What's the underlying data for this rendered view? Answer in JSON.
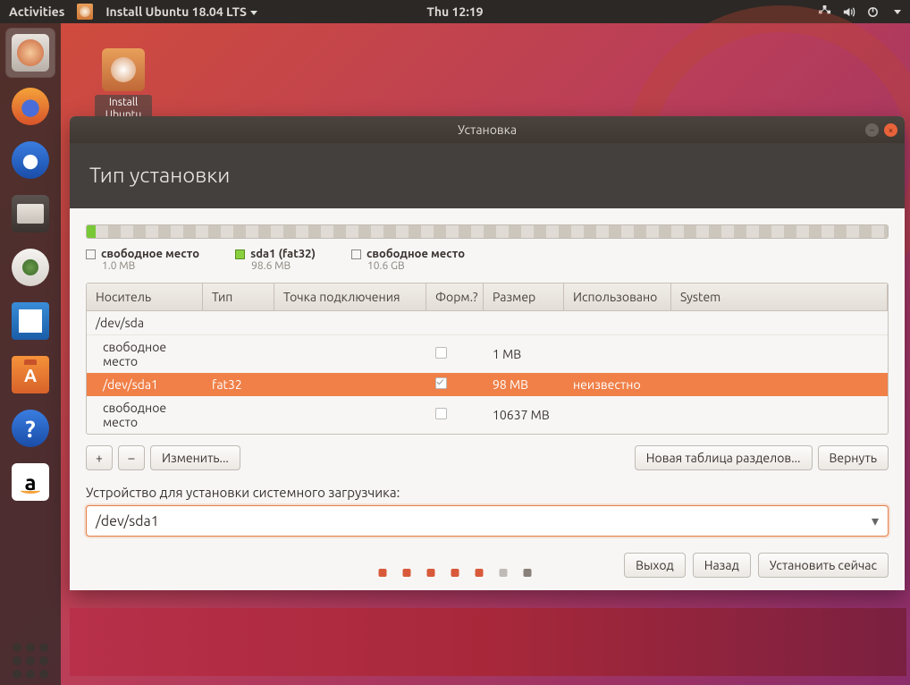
{
  "topbar": {
    "activities": "Activities",
    "app_title": "Install Ubuntu 18.04 LTS",
    "clock": "Thu 12:19"
  },
  "desktop_icon": {
    "label": "Install Ubuntu"
  },
  "window": {
    "title": "Установка",
    "heading": "Тип установки"
  },
  "legend": {
    "item0": {
      "label": "свободное место",
      "size": "1.0 MB"
    },
    "item1": {
      "label": "sda1 (fat32)",
      "size": "98.6 MB"
    },
    "item2": {
      "label": "свободное место",
      "size": "10.6 GB"
    }
  },
  "columns": {
    "device": "Носитель",
    "type": "Тип",
    "mount": "Точка подключения",
    "format": "Форм.?",
    "size": "Размер",
    "used": "Использовано",
    "system": "System"
  },
  "rows": {
    "r0": {
      "device": "/dev/sda",
      "type": "",
      "mount": "",
      "size": "",
      "used": ""
    },
    "r1": {
      "device": "свободное место",
      "type": "",
      "mount": "",
      "size": "1 MB",
      "used": ""
    },
    "r2": {
      "device": "/dev/sda1",
      "type": "fat32",
      "mount": "",
      "size": "98 MB",
      "used": "неизвестно"
    },
    "r3": {
      "device": "свободное место",
      "type": "",
      "mount": "",
      "size": "10637 MB",
      "used": ""
    }
  },
  "buttons": {
    "plus": "+",
    "minus": "–",
    "change": "Изменить...",
    "new_table": "Новая таблица разделов...",
    "revert": "Вернуть",
    "quit": "Выход",
    "back": "Назад",
    "install": "Установить сейчас"
  },
  "bootloader": {
    "label": "Устройство для установки системного загрузчика:",
    "value": "/dev/sda1"
  }
}
